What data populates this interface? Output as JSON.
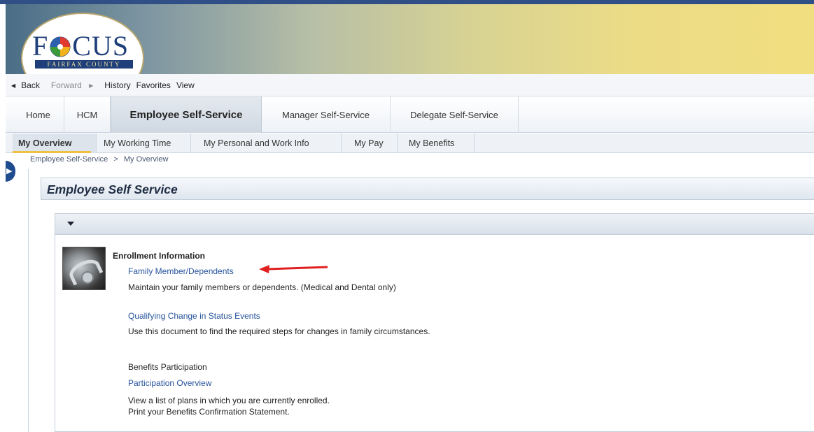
{
  "logo": {
    "text_pre": "F",
    "text_post": "CUS",
    "ribbon": "FAIRFAX COUNTY"
  },
  "history_bar": {
    "back": "Back",
    "forward": "Forward",
    "history": "History",
    "favorites": "Favorites",
    "view": "View"
  },
  "top_nav": {
    "tabs": [
      {
        "label": "Home"
      },
      {
        "label": "HCM"
      },
      {
        "label": "Employee Self-Service"
      },
      {
        "label": "Manager Self-Service"
      },
      {
        "label": "Delegate Self-Service"
      }
    ],
    "active": "Employee Self-Service"
  },
  "sub_nav": {
    "tabs": [
      {
        "label": "My Overview"
      },
      {
        "label": "My Working Time"
      },
      {
        "label": "My Personal and Work Info"
      },
      {
        "label": "My Pay"
      },
      {
        "label": "My Benefits"
      }
    ],
    "active": "My Overview"
  },
  "breadcrumb": {
    "root": "Employee Self-Service",
    "separator": ">",
    "current": "My Overview"
  },
  "page": {
    "title": "Employee Self Service"
  },
  "sections": {
    "enrollment": {
      "heading": "Enrollment Information",
      "link1": "Family Member/Dependents",
      "desc1": "Maintain your family members or dependents. (Medical and Dental only)",
      "link2": "Qualifying Change in Status Events",
      "desc2": "Use this document to find the required steps for changes in family circumstances."
    },
    "benefits": {
      "heading": "Benefits Participation",
      "link": "Participation Overview",
      "desc1": "View a list of plans in which you are currently enrolled.",
      "desc2": "Print your Benefits Confirmation Statement."
    }
  },
  "colors": {
    "link": "#27549c",
    "annotation_arrow": "#e02020",
    "nav_toggle": "#1f4b8f"
  }
}
